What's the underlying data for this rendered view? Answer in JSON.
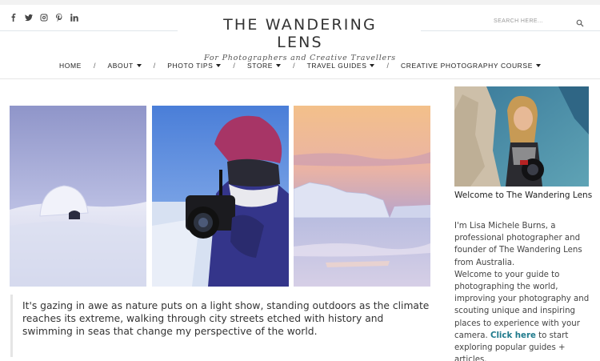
{
  "header": {
    "social": [
      {
        "icon": "facebook-icon"
      },
      {
        "icon": "twitter-icon"
      },
      {
        "icon": "instagram-icon"
      },
      {
        "icon": "pinterest-icon"
      },
      {
        "icon": "linkedin-icon"
      }
    ],
    "logo_title": "THE WANDERING LENS",
    "logo_tagline": "For Photographers and Creative Travellers",
    "search_placeholder": "SEARCH HERE...",
    "search_icon": "search-icon"
  },
  "nav": {
    "items": [
      {
        "label": "HOME",
        "dropdown": false
      },
      {
        "label": "ABOUT",
        "dropdown": true
      },
      {
        "label": "PHOTO TIPS",
        "dropdown": true
      },
      {
        "label": "STORE",
        "dropdown": true
      },
      {
        "label": "TRAVEL GUIDES",
        "dropdown": true
      },
      {
        "label": "CREATIVE PHOTOGRAPHY COURSE",
        "dropdown": true
      }
    ],
    "separator": "/"
  },
  "main": {
    "quote": "It's gazing in awe as nature puts on a light show, standing outdoors as the climate reaches its extreme, walking through city streets etched with history and swimming in seas that change my perspective of the world."
  },
  "sidebar": {
    "title": "Welcome to The Wandering Lens",
    "intro": "I'm Lisa Michele Burns, a professional photographer and founder of The Wandering Lens from Australia.",
    "guide_text": "Welcome to your guide to photographing the world, improving your photography and scouting unique and inspiring places to experience with your camera.",
    "link_label": "Click here",
    "link_suffix": " to start exploring popular guides + articles."
  },
  "colors": {
    "link": "#1f7a8c",
    "text": "#333333",
    "rule": "#dfe6ea"
  }
}
